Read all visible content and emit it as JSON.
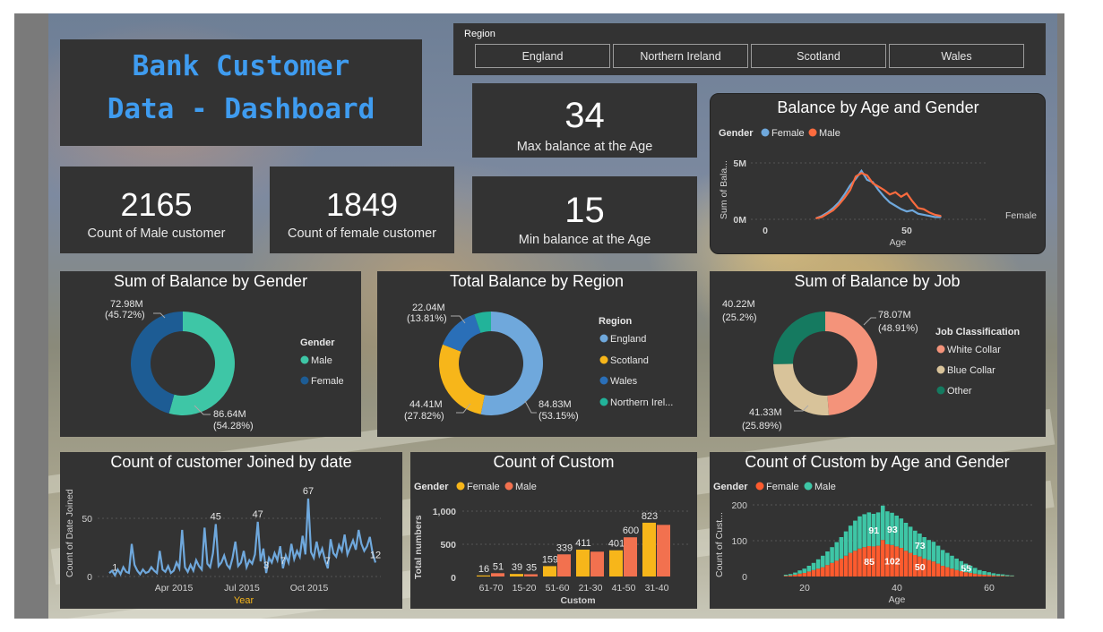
{
  "title": {
    "line1": "Bank Customer",
    "line2": "Data - Dashboard"
  },
  "kpis": {
    "male": {
      "value": "2165",
      "label": "Count of Male customer"
    },
    "female": {
      "value": "1849",
      "label": "Count of female customer"
    },
    "max": {
      "value": "34",
      "label": "Max balance at the Age"
    },
    "min": {
      "value": "15",
      "label": "Min balance at the Age"
    }
  },
  "slicer": {
    "label": "Region",
    "options": [
      "England",
      "Northern Ireland",
      "Scotland",
      "Wales"
    ]
  },
  "colors": {
    "female_orange": "#fd6b3e",
    "female_blue": "#5aa0e0",
    "male_orange": "#fd6b3e",
    "teal": "#3ec6a6",
    "navy": "#1d5c94",
    "gold": "#f7b61a",
    "salmon": "#f4937a",
    "tan": "#d8c39a",
    "green": "#157a60",
    "panel": "#333333"
  },
  "chart_data": [
    {
      "id": "balance_by_age_gender",
      "type": "line",
      "title": "Balance by Age and Gender",
      "legend_title": "Gender",
      "xlabel": "Age",
      "ylabel": "Sum of Bala...",
      "y_ticks": [
        "0M",
        "5M"
      ],
      "x_ticks": [
        "0",
        "50"
      ],
      "ylim": [
        0,
        6
      ],
      "xlim": [
        0,
        90
      ],
      "side_label": "Female",
      "x": [
        18,
        20,
        22,
        24,
        26,
        28,
        30,
        32,
        34,
        36,
        38,
        40,
        42,
        44,
        46,
        48,
        50,
        52,
        54,
        56,
        58,
        60,
        62
      ],
      "series": [
        {
          "name": "Female",
          "color": "#6fa8dc",
          "values": [
            0.1,
            0.3,
            0.6,
            1.0,
            1.5,
            2.2,
            3.0,
            3.6,
            4.3,
            3.5,
            3.3,
            2.6,
            2.0,
            1.5,
            1.2,
            0.9,
            0.7,
            0.8,
            0.5,
            0.4,
            0.3,
            0.2,
            0.2
          ]
        },
        {
          "name": "Male",
          "color": "#fd6b3e",
          "values": [
            0.1,
            0.2,
            0.5,
            0.8,
            1.3,
            1.9,
            2.6,
            3.8,
            4.1,
            3.9,
            3.2,
            2.9,
            2.6,
            2.2,
            2.4,
            2.0,
            2.3,
            1.6,
            1.0,
            0.9,
            0.6,
            0.4,
            0.3
          ]
        }
      ]
    },
    {
      "id": "sum_balance_gender",
      "type": "pie",
      "title": "Sum of Balance by Gender",
      "legend_title": "Gender",
      "slices": [
        {
          "name": "Male",
          "value": 86.64,
          "label": "86.64M",
          "pct": "(54.28%)",
          "color": "#3ec6a6"
        },
        {
          "name": "Female",
          "value": 72.98,
          "label": "72.98M",
          "pct": "(45.72%)",
          "color": "#1d5c94"
        }
      ]
    },
    {
      "id": "total_balance_region",
      "type": "pie",
      "title": "Total Balance by Region",
      "legend_title": "Region",
      "slices": [
        {
          "name": "England",
          "value": 84.83,
          "label": "84.83M",
          "pct": "(53.15%)",
          "color": "#6fa8dc"
        },
        {
          "name": "Scotland",
          "value": 44.41,
          "label": "44.41M",
          "pct": "(27.82%)",
          "color": "#f7b61a"
        },
        {
          "name": "Wales",
          "value": 22.04,
          "label": "22.04M",
          "pct": "(13.81%)",
          "color": "#2a6fb8"
        },
        {
          "name": "Northern Irel...",
          "value": 8.33,
          "label": "",
          "pct": "",
          "color": "#22b39a"
        }
      ]
    },
    {
      "id": "sum_balance_job",
      "type": "pie",
      "title": "Sum of Balance by Job",
      "legend_title": "Job Classification",
      "slices": [
        {
          "name": "White Collar",
          "value": 78.07,
          "label": "78.07M",
          "pct": "(48.91%)",
          "color": "#f4937a"
        },
        {
          "name": "Blue Collar",
          "value": 41.33,
          "label": "41.33M",
          "pct": "(25.89%)",
          "color": "#d8c39a"
        },
        {
          "name": "Other",
          "value": 40.22,
          "label": "40.22M",
          "pct": "(25.2%)",
          "color": "#157a60"
        }
      ]
    },
    {
      "id": "joined_by_date",
      "type": "line",
      "title": "Count of customer Joined by date",
      "xlabel": "Year",
      "ylabel": "Count of Date Joined",
      "y_ticks": [
        0,
        50
      ],
      "x_ticks": [
        "Apr 2015",
        "Jul 2015",
        "Oct 2015"
      ],
      "ylim": [
        0,
        70
      ],
      "data_labels": [
        {
          "index": 2,
          "text": "1"
        },
        {
          "index": 38,
          "text": "45"
        },
        {
          "index": 53,
          "text": "47"
        },
        {
          "index": 71,
          "text": "67"
        },
        {
          "index": 56,
          "text": "3"
        },
        {
          "index": 62,
          "text": "7"
        },
        {
          "index": 78,
          "text": "7"
        },
        {
          "index": 95,
          "text": "12"
        }
      ],
      "values": [
        3,
        5,
        1,
        6,
        2,
        8,
        4,
        3,
        28,
        10,
        5,
        2,
        6,
        3,
        4,
        8,
        5,
        3,
        22,
        6,
        4,
        9,
        3,
        5,
        12,
        7,
        40,
        8,
        4,
        10,
        5,
        14,
        9,
        6,
        42,
        11,
        8,
        20,
        45,
        9,
        12,
        18,
        10,
        7,
        16,
        30,
        9,
        12,
        22,
        8,
        14,
        11,
        19,
        47,
        13,
        24,
        3,
        16,
        12,
        20,
        14,
        26,
        7,
        18,
        12,
        28,
        15,
        22,
        17,
        35,
        19,
        67,
        21,
        16,
        30,
        18,
        24,
        14,
        7,
        32,
        20,
        17,
        27,
        22,
        36,
        19,
        25,
        31,
        23,
        40,
        28,
        22,
        26,
        34,
        20,
        12
      ]
    },
    {
      "id": "count_custom",
      "type": "bar",
      "title": "Count of Custom",
      "legend_title": "Gender",
      "xlabel": "Custom",
      "ylabel": "Total numbers",
      "y_ticks": [
        "0",
        "500",
        "1,000"
      ],
      "ylim": [
        0,
        1200
      ],
      "categories": [
        "61-70",
        "15-20",
        "51-60",
        "21-30",
        "41-50",
        "31-40"
      ],
      "series": [
        {
          "name": "Female",
          "color": "#f7b61a",
          "values": [
            16,
            39,
            159,
            411,
            401,
            823
          ],
          "labels": [
            "16",
            "39",
            "159",
            "411",
            "401",
            "823"
          ]
        },
        {
          "name": "Male",
          "color": "#f2714f",
          "values": [
            51,
            35,
            339,
            380,
            600,
            790
          ],
          "labels": [
            "51",
            "35",
            "339",
            "",
            "600",
            ""
          ]
        }
      ]
    },
    {
      "id": "count_custom_age_gender",
      "type": "bar",
      "title": "Count of Custom by Age and Gender",
      "legend_title": "Gender",
      "xlabel": "Age",
      "ylabel": "Count of Cust...",
      "y_ticks": [
        "0",
        "100",
        "200"
      ],
      "x_ticks": [
        "20",
        "40",
        "60"
      ],
      "ylim": [
        0,
        220
      ],
      "xlim": [
        12,
        68
      ],
      "x": [
        16,
        17,
        18,
        19,
        20,
        21,
        22,
        23,
        24,
        25,
        26,
        27,
        28,
        29,
        30,
        31,
        32,
        33,
        34,
        35,
        36,
        37,
        38,
        39,
        40,
        41,
        42,
        43,
        44,
        45,
        46,
        47,
        48,
        49,
        50,
        51,
        52,
        53,
        54,
        55,
        56,
        57,
        58,
        59,
        60,
        61,
        62,
        63,
        64,
        65
      ],
      "series": [
        {
          "name": "Female",
          "color": "#fd5b2e",
          "values": [
            2,
            3,
            5,
            8,
            10,
            14,
            18,
            22,
            26,
            32,
            38,
            44,
            50,
            58,
            66,
            72,
            78,
            82,
            85,
            84,
            86,
            102,
            90,
            88,
            84,
            80,
            72,
            66,
            60,
            56,
            50,
            46,
            42,
            36,
            30,
            26,
            22,
            18,
            15,
            12,
            10,
            8,
            6,
            5,
            4,
            3,
            2,
            2,
            1,
            1
          ]
        },
        {
          "name": "Male",
          "color": "#3ec6a6",
          "values": [
            3,
            4,
            6,
            9,
            12,
            16,
            20,
            26,
            32,
            38,
            44,
            52,
            60,
            68,
            76,
            84,
            90,
            92,
            94,
            91,
            93,
            96,
            92,
            90,
            86,
            82,
            78,
            73,
            68,
            64,
            60,
            56,
            55,
            50,
            44,
            40,
            36,
            32,
            28,
            24,
            20,
            16,
            12,
            10,
            8,
            6,
            5,
            4,
            3,
            2
          ]
        }
      ],
      "data_labels": [
        {
          "x": 35,
          "text": "91"
        },
        {
          "x": 39,
          "text": "93"
        },
        {
          "x": 45,
          "text": "73"
        },
        {
          "x": 55,
          "text": "55"
        },
        {
          "x": 34,
          "text": "85"
        },
        {
          "x": 39,
          "text": "102"
        },
        {
          "x": 45,
          "text": "50"
        }
      ]
    }
  ]
}
